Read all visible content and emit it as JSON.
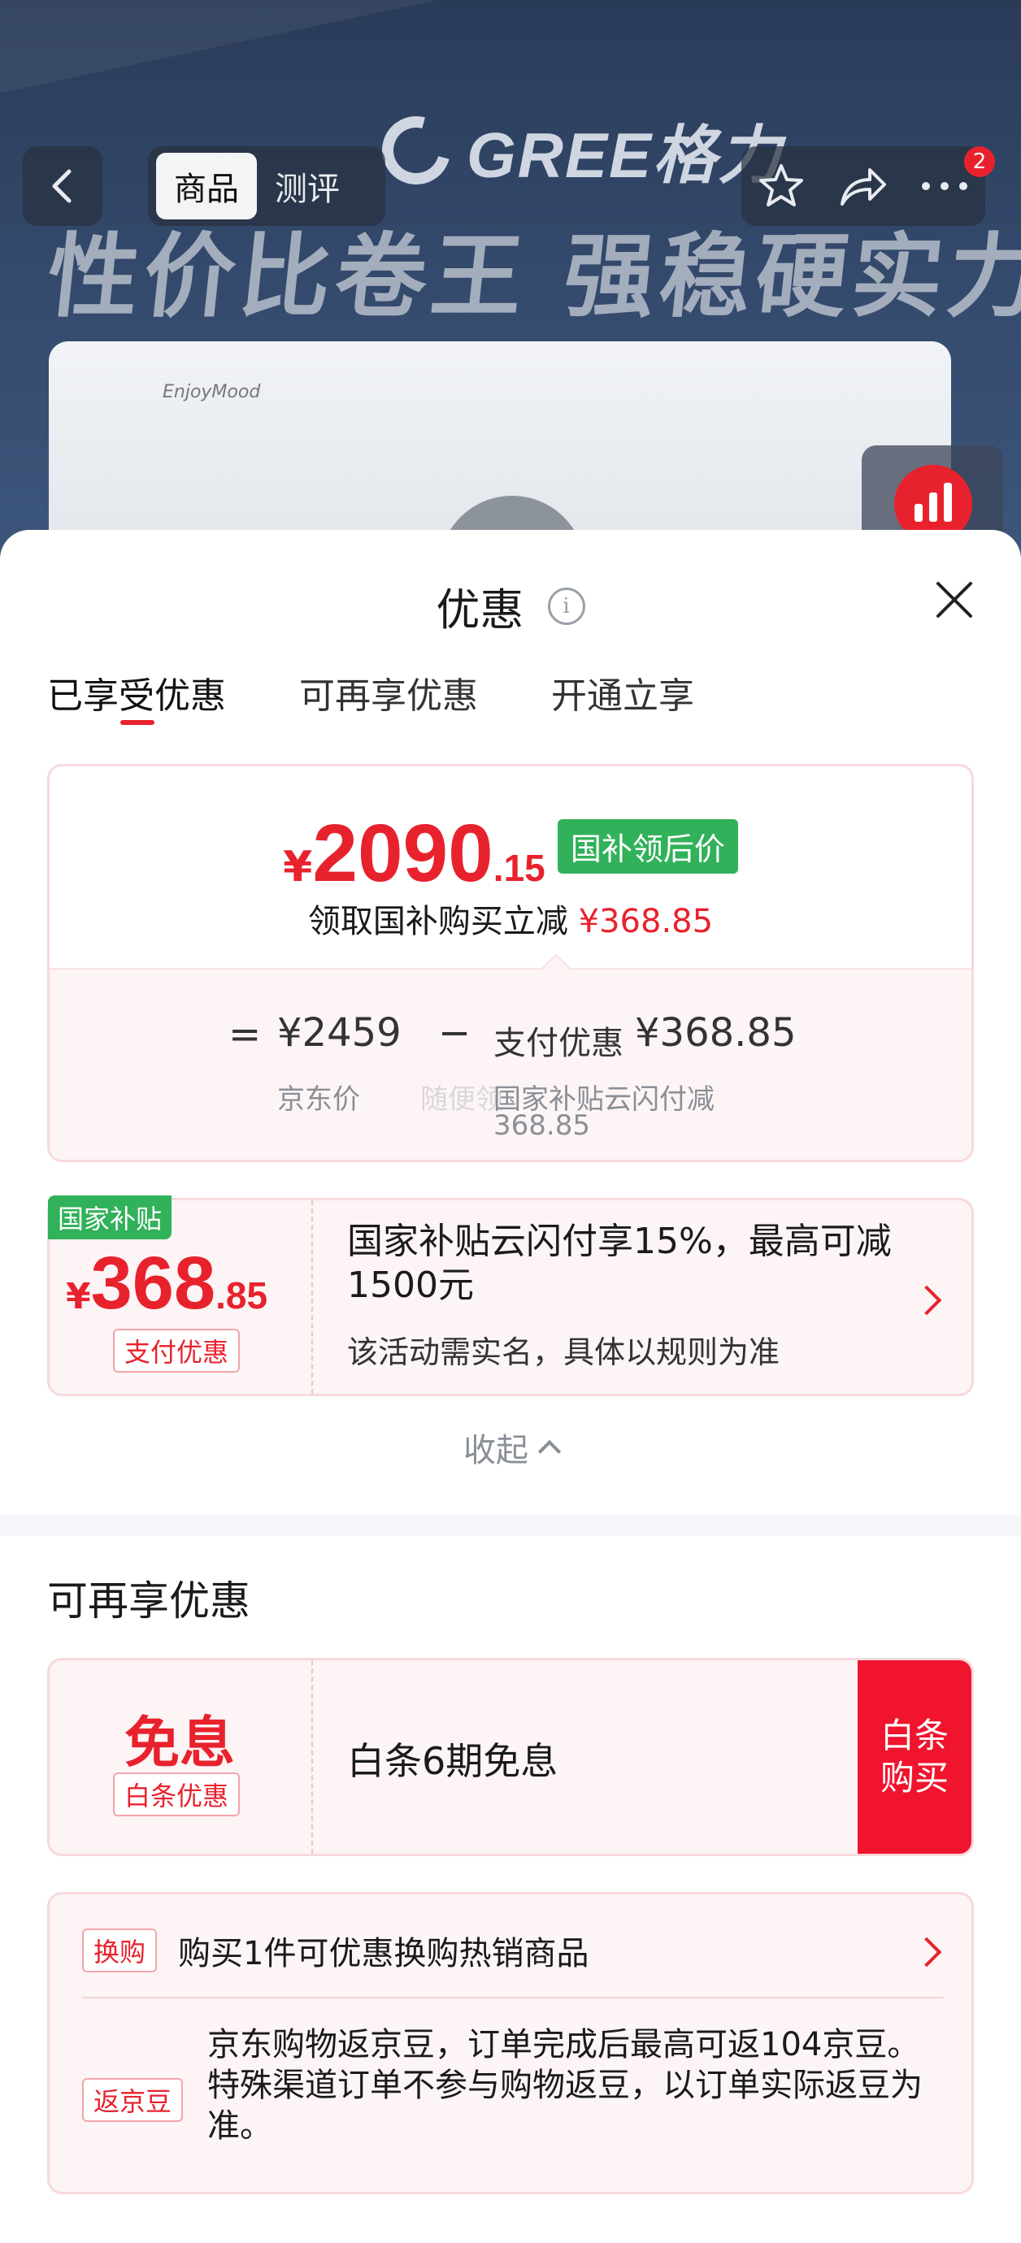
{
  "nav": {
    "tabs": [
      {
        "label": "商品",
        "active": true
      },
      {
        "label": "测评",
        "active": false
      }
    ],
    "badge_count": "2"
  },
  "hero": {
    "brand": "GREE格力",
    "slogan": "性价比卷王 强稳硬实力",
    "unit_brand": "EnjoyMood"
  },
  "sheet": {
    "title": "优惠",
    "tabs": [
      {
        "label": "已享受优惠",
        "active": true
      },
      {
        "label": "可再享优惠",
        "active": false
      },
      {
        "label": "开通立享",
        "active": false
      }
    ],
    "summary": {
      "currency": "¥",
      "price_int": "2090",
      "price_dec": ".15",
      "price_tag": "国补领后价",
      "sub_text": "领取国补购买立减",
      "sub_amount": "¥368.85",
      "eq": "=",
      "jd_price": "¥2459",
      "minus": "−",
      "pay_discount_label": "支付优惠",
      "pay_discount_amount": "¥368.85",
      "jd_price_caption": "京东价",
      "ghost_text": "随便领",
      "discount_caption_1": "国家补贴云闪付减",
      "discount_caption_2": "368.85"
    },
    "subsidy_card": {
      "corner_tag": "国家补贴",
      "currency": "¥",
      "amount_int": "368",
      "amount_dec": ".85",
      "tag": "支付优惠",
      "desc": "国家补贴云闪付享15%，最高可减1500元",
      "note": "该活动需实名，具体以规则为准"
    },
    "collapse_label": "收起",
    "more_section_title": "可再享优惠",
    "baitiao_card": {
      "headline": "免息",
      "tag": "白条优惠",
      "desc": "白条6期免息",
      "button_line1": "白条",
      "button_line2": "购买"
    },
    "extra_card": {
      "row1_tag": "换购",
      "row1_text": "购买1件可优惠换购热销商品",
      "row2_tag": "返京豆",
      "row2_text": "京东购物返京豆，订单完成后最高可返104京豆。特殊渠道订单不参与购物返豆，以订单实际返豆为准。"
    }
  },
  "colors": {
    "accent_red": "#e8222d",
    "green_tag": "#31b15a",
    "card_border": "#f7d9dc",
    "card_bg": "#fdf4f5"
  }
}
